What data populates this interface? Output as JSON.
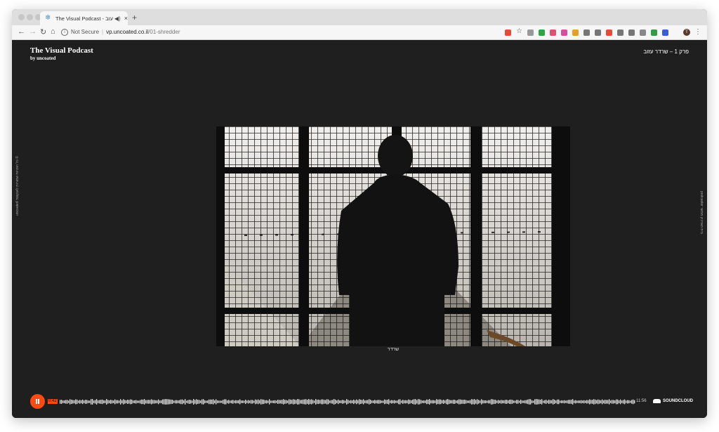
{
  "browser": {
    "tab_title": "The Visual Podcast - עוב",
    "new_tab": "+",
    "url_status": "Not Secure",
    "url_host": "vp.uncoated.co.il",
    "url_path": "/01-shredder",
    "avatar_letter": "T",
    "menu": "⋮",
    "extension_colors": [
      "#e84a3a",
      "#c6c6c6",
      "#999",
      "#27a844",
      "#e05070",
      "#d94da0",
      "#e8a020",
      "#777",
      "#777",
      "#e84a3a",
      "#777",
      "#777",
      "#888",
      "#2f9e44",
      "#3b5bd9"
    ]
  },
  "site": {
    "brand_title": "The Visual Podcast",
    "brand_sub": "by uncoated",
    "episode_title": "פרק 1 – שרדר עזוב",
    "side_left": "© כל הזכויות שמורות לאנקוטד uncoated",
    "side_right": "בית הארכיון ממשי podcaster",
    "caption": "שרדר"
  },
  "player": {
    "current_time": "0:42",
    "total_time": "11:56",
    "brand": "SOUNDCLOUD",
    "progress": 0.0,
    "accent": "#ff4a14"
  }
}
